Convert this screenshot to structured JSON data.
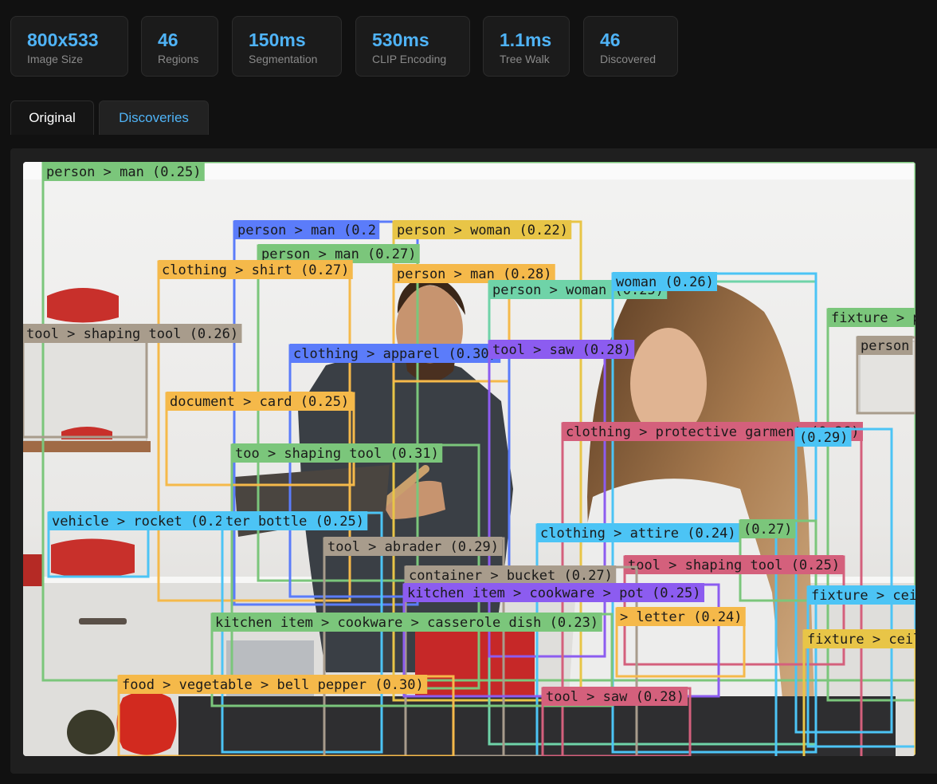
{
  "stats": [
    {
      "value": "800x533",
      "label": "Image Size"
    },
    {
      "value": "46",
      "label": "Regions"
    },
    {
      "value": "150ms",
      "label": "Segmentation"
    },
    {
      "value": "530ms",
      "label": "CLIP Encoding"
    },
    {
      "value": "1.1ms",
      "label": "Tree Walk"
    },
    {
      "value": "46",
      "label": "Discovered"
    }
  ],
  "tabs": {
    "original": "Original",
    "discoveries": "Discoveries"
  },
  "detections": [
    {
      "label": "person > man (0.25)",
      "color": "#7bc67b"
    },
    {
      "label": "person > man (0.2",
      "color": "#5b7cfa"
    },
    {
      "label": "person > woman (0.22)",
      "color": "#e8c547"
    },
    {
      "label": "person > man (0.27)",
      "color": "#7bc67b"
    },
    {
      "label": "person > man (0.28)",
      "color": "#f5b94a"
    },
    {
      "label": "clothing > shirt (0.27)",
      "color": "#f5b94a"
    },
    {
      "label": "person > woman (0.25)",
      "color": "#6fd3a8"
    },
    {
      "label": "woman (0.26)",
      "color": "#4cc4f5"
    },
    {
      "label": "fixture > p",
      "color": "#7bc67b"
    },
    {
      "label": "person",
      "color": "#a89c8c"
    },
    {
      "label": "tool > shaping tool (0.26)",
      "color": "#a89c8c"
    },
    {
      "label": "clothing > apparel (0.30)",
      "color": "#5b7cfa"
    },
    {
      "label": "tool > saw (0.28)",
      "color": "#8c5cf0"
    },
    {
      "label": "document > card (0.25)",
      "color": "#f5b94a"
    },
    {
      "label": "clothing > protective garment (0.26)",
      "color": "#d4607c"
    },
    {
      "label": "(0.29)",
      "color": "#4cc4f5"
    },
    {
      "label": "too > shaping tool (0.31)",
      "color": "#7bc67b"
    },
    {
      "label": "vehicle > rocket (0.23)",
      "color": "#4cc4f5"
    },
    {
      "label": "ter bottle (0.25)",
      "color": "#4cc4f5"
    },
    {
      "label": "tool > abrader (0.29)",
      "color": "#a89c8c"
    },
    {
      "label": "clothing > attire (0.24)",
      "color": "#4cc4f5"
    },
    {
      "label": "(0.27)",
      "color": "#7bc67b"
    },
    {
      "label": "tool > shaping tool (0.25)",
      "color": "#d4607c"
    },
    {
      "label": "container > bucket (0.27)",
      "color": "#a89c8c"
    },
    {
      "label": "kitchen item > cookware > pot (0.25)",
      "color": "#8c5cf0"
    },
    {
      "label": "fixture > ceil",
      "color": "#4cc4f5"
    },
    {
      "label": "kitchen item > cookware > casserole dish (0.23)",
      "color": "#7bc67b"
    },
    {
      "label": "> letter (0.24)",
      "color": "#f5b94a"
    },
    {
      "label": "fixture > ceili",
      "color": "#e8c547"
    },
    {
      "label": "food > vegetable > bell pepper (0.30)",
      "color": "#f5b94a"
    },
    {
      "label": "tool > saw (0.28)",
      "color": "#d4607c"
    }
  ]
}
